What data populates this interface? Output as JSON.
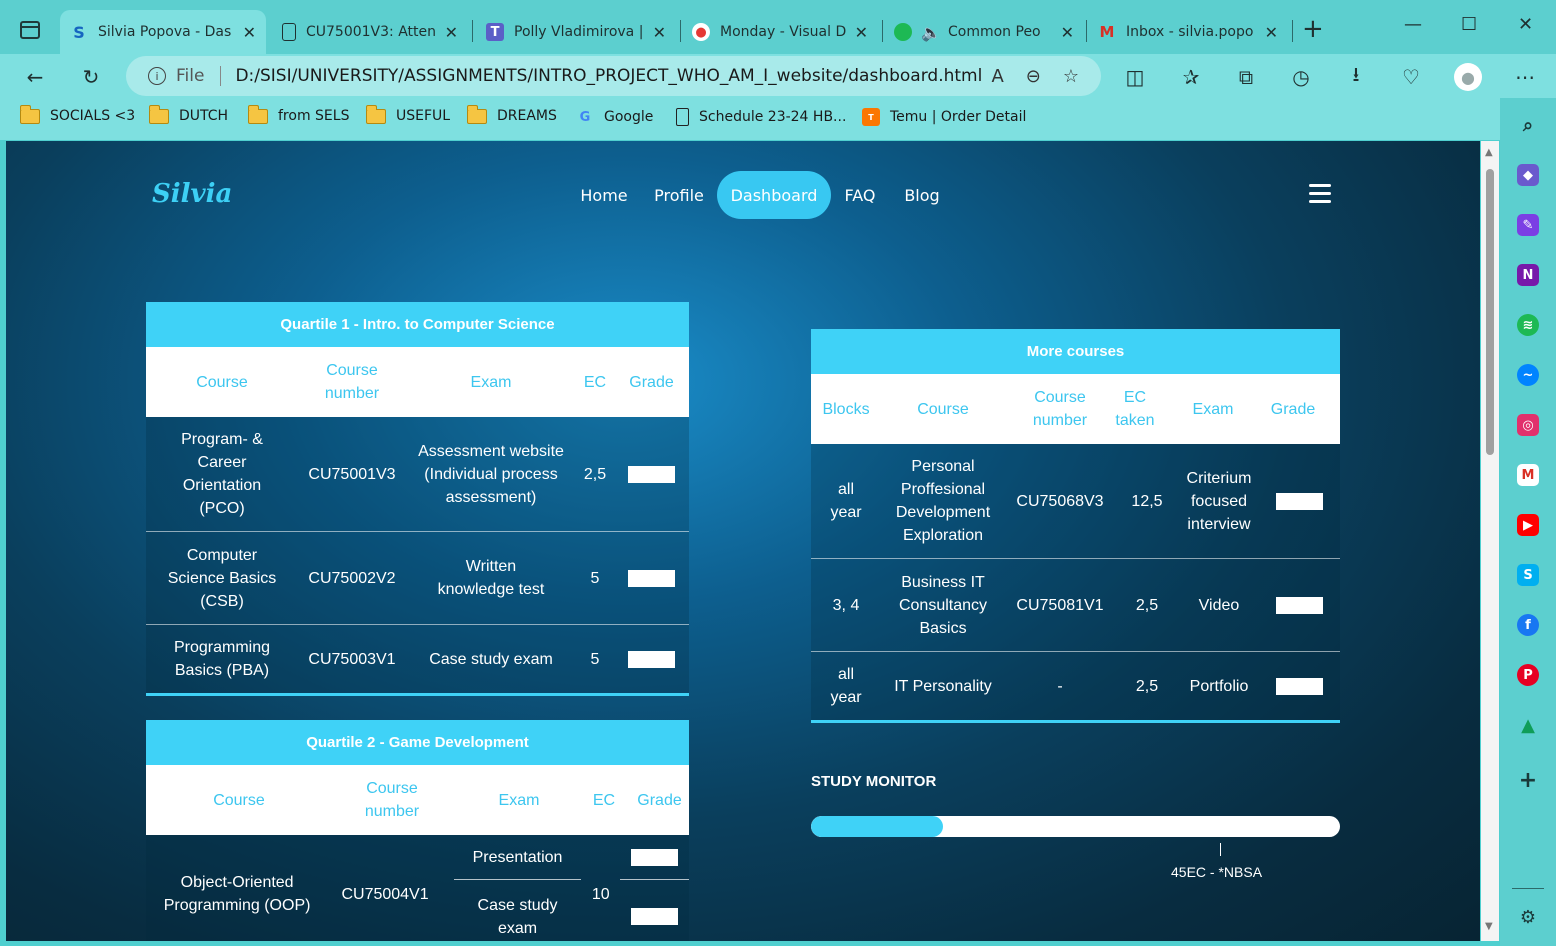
{
  "browser": {
    "tabs": [
      {
        "title": "Silvia Popova - Das",
        "icon": "site-s-icon"
      },
      {
        "title": "CU75001V3: Atten",
        "icon": "document-icon"
      },
      {
        "title": "Polly Vladimirova |",
        "icon": "teams-icon"
      },
      {
        "title": "Monday - Visual D",
        "icon": "clown-icon"
      },
      {
        "title": "Common Peo",
        "icon": "spotify-icon"
      },
      {
        "title": "Inbox - silvia.popo",
        "icon": "gmail-icon"
      }
    ],
    "address": {
      "scheme": "File",
      "url": "D:/SISI/UNIVERSITY/ASSIGNMENTS/INTRO_PROJECT_WHO_AM_I_website/dashboard.html"
    },
    "bookmarks": [
      {
        "label": "SOCIALS <3",
        "icon": "folder-icon"
      },
      {
        "label": "DUTCH",
        "icon": "folder-icon"
      },
      {
        "label": "from SELS",
        "icon": "folder-icon"
      },
      {
        "label": "USEFUL",
        "icon": "folder-icon"
      },
      {
        "label": "DREAMS",
        "icon": "folder-icon"
      },
      {
        "label": "Google",
        "icon": "google-icon"
      },
      {
        "label": "Schedule 23-24 HB...",
        "icon": "document-icon"
      },
      {
        "label": "Temu | Order Detail",
        "icon": "temu-icon"
      }
    ]
  },
  "site": {
    "logo": "Silvia",
    "nav": [
      {
        "label": "Home",
        "active": false
      },
      {
        "label": "Profile",
        "active": false
      },
      {
        "label": "Dashboard",
        "active": true
      },
      {
        "label": "FAQ",
        "active": false
      },
      {
        "label": "Blog",
        "active": false
      }
    ]
  },
  "q1": {
    "title": "Quartile 1 - Intro. to Computer Science",
    "headers": [
      "Course",
      "Course number",
      "Exam",
      "EC",
      "Grade"
    ],
    "rows": [
      {
        "course": "Program- & Career Orientation (PCO)",
        "number": "CU75001V3",
        "exam": "Assessment website (Individual process assessment)",
        "ec": "2,5"
      },
      {
        "course": "Computer Science Basics (CSB)",
        "number": "CU75002V2",
        "exam": "Written knowledge test",
        "ec": "5"
      },
      {
        "course": "Programming Basics (PBA)",
        "number": "CU75003V1",
        "exam": "Case study exam",
        "ec": "5"
      }
    ]
  },
  "q2": {
    "title": "Quartile 2 - Game Development",
    "headers": [
      "Course",
      "Course number",
      "Exam",
      "EC",
      "Grade"
    ],
    "rows": [
      {
        "course": "Object-Oriented Programming (OOP)",
        "number": "CU75004V1",
        "exam1": "Presentation",
        "exam2": "Case study exam",
        "ec": "10"
      }
    ]
  },
  "more": {
    "title": "More courses",
    "headers": [
      "Blocks",
      "Course",
      "Course number",
      "EC taken",
      "Exam",
      "Grade"
    ],
    "rows": [
      {
        "blocks": "all year",
        "course": "Personal Proffesional Development Exploration",
        "number": "CU75068V3",
        "ec": "12,5",
        "exam": "Criterium focused interview"
      },
      {
        "blocks": "3, 4",
        "course": "Business IT Consultancy Basics",
        "number": "CU75081V1",
        "ec": "2,5",
        "exam": "Video"
      },
      {
        "blocks": "all year",
        "course": "IT Personality",
        "number": "-",
        "ec": "2,5",
        "exam": "Portfolio"
      }
    ]
  },
  "monitor": {
    "title": "STUDY MONITOR",
    "progress_fraction": 0.25,
    "marker_label": "45EC - *NBSA",
    "marker_fraction": 0.77
  }
}
